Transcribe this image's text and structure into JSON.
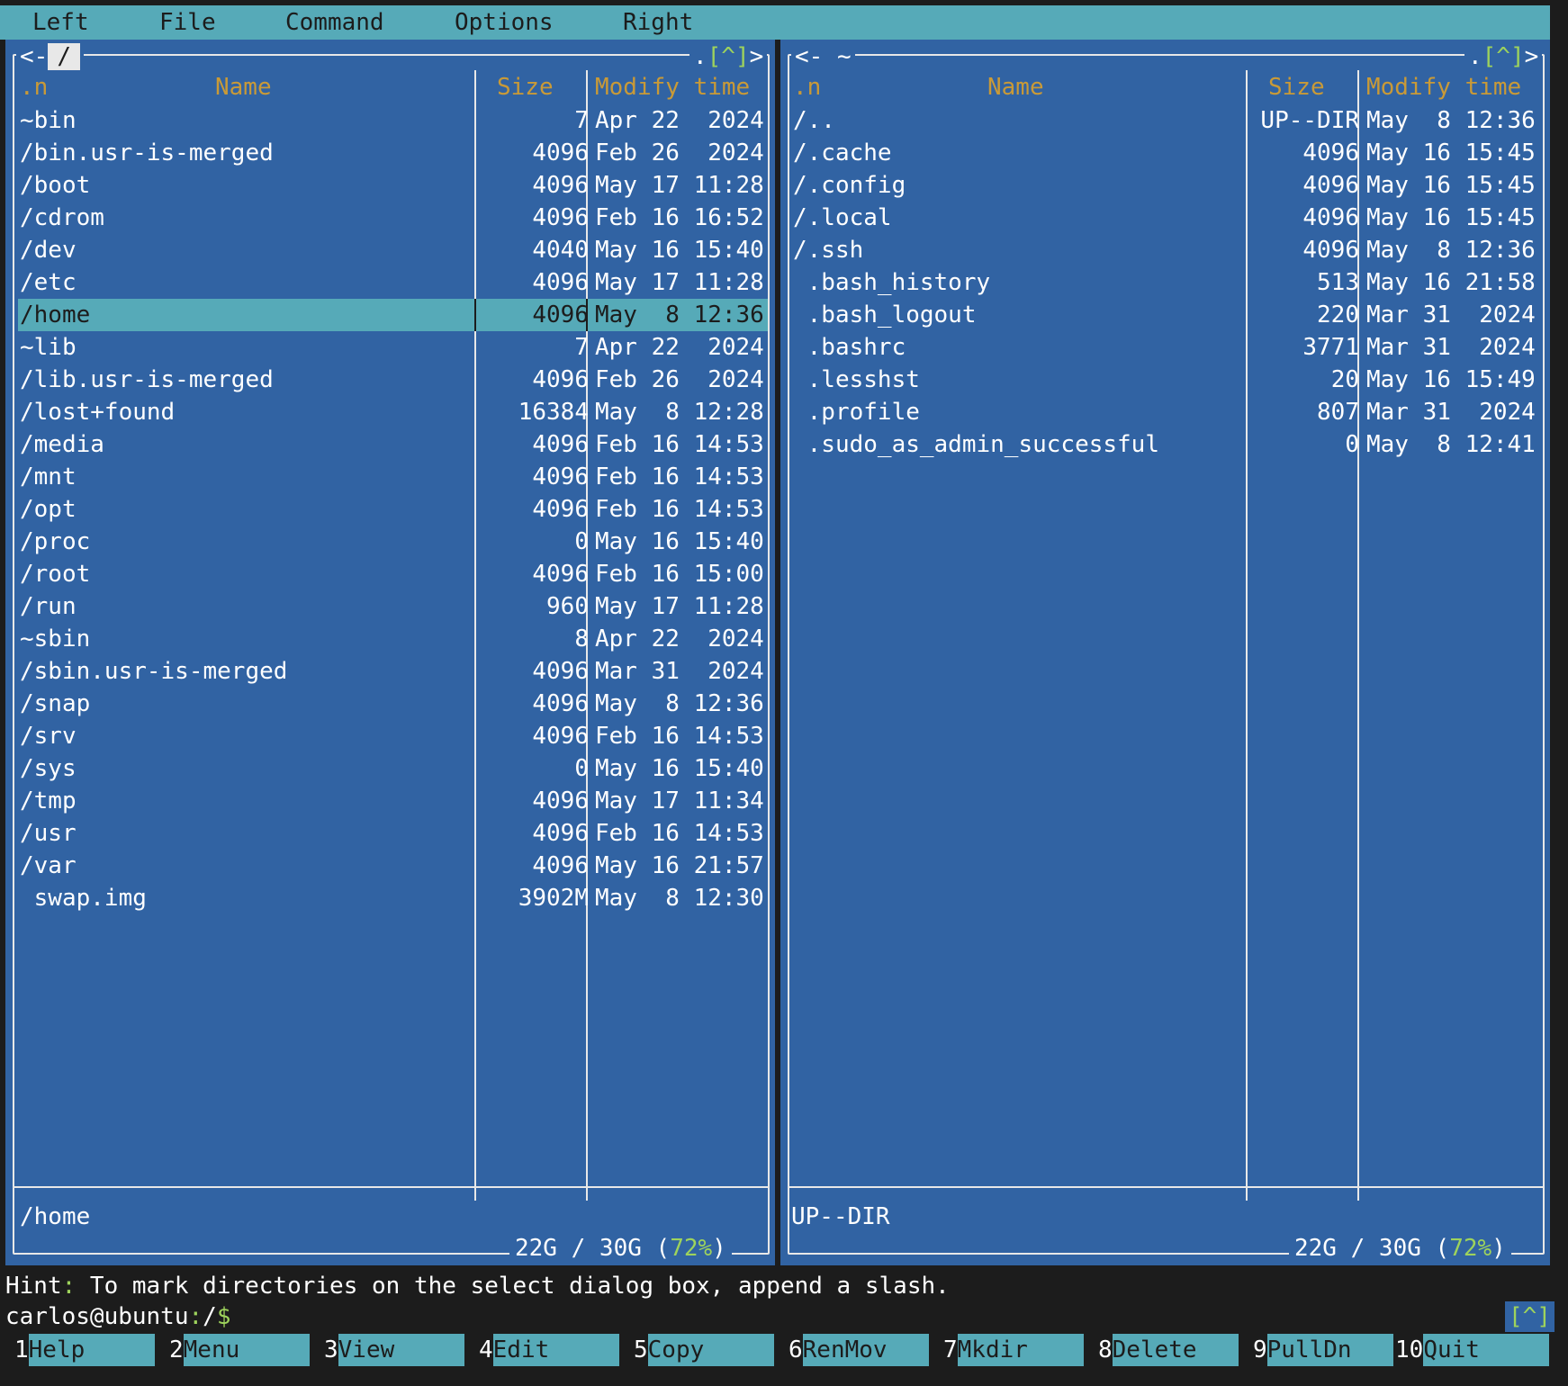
{
  "menubar": [
    "Left",
    "File",
    "Command",
    "Options",
    "Right"
  ],
  "left_panel": {
    "title_left": "<-",
    "path": "/",
    "title_right_dot": ".",
    "history_label": "[^]",
    "title_right_arrow": ">",
    "columns": {
      "n": ".n",
      "name": "Name",
      "size": "Size",
      "time": "Modify time"
    },
    "rows": [
      {
        "name": "~bin",
        "size": "7",
        "time": "Apr 22  2024"
      },
      {
        "name": "/bin.usr-is-merged",
        "size": "4096",
        "time": "Feb 26  2024"
      },
      {
        "name": "/boot",
        "size": "4096",
        "time": "May 17 11:28"
      },
      {
        "name": "/cdrom",
        "size": "4096",
        "time": "Feb 16 16:52"
      },
      {
        "name": "/dev",
        "size": "4040",
        "time": "May 16 15:40"
      },
      {
        "name": "/etc",
        "size": "4096",
        "time": "May 17 11:28"
      },
      {
        "name": "/home",
        "size": "4096",
        "time": "May  8 12:36",
        "selected": true
      },
      {
        "name": "~lib",
        "size": "7",
        "time": "Apr 22  2024"
      },
      {
        "name": "/lib.usr-is-merged",
        "size": "4096",
        "time": "Feb 26  2024"
      },
      {
        "name": "/lost+found",
        "size": "16384",
        "time": "May  8 12:28"
      },
      {
        "name": "/media",
        "size": "4096",
        "time": "Feb 16 14:53"
      },
      {
        "name": "/mnt",
        "size": "4096",
        "time": "Feb 16 14:53"
      },
      {
        "name": "/opt",
        "size": "4096",
        "time": "Feb 16 14:53"
      },
      {
        "name": "/proc",
        "size": "0",
        "time": "May 16 15:40"
      },
      {
        "name": "/root",
        "size": "4096",
        "time": "Feb 16 15:00"
      },
      {
        "name": "/run",
        "size": "960",
        "time": "May 17 11:28"
      },
      {
        "name": "~sbin",
        "size": "8",
        "time": "Apr 22  2024"
      },
      {
        "name": "/sbin.usr-is-merged",
        "size": "4096",
        "time": "Mar 31  2024"
      },
      {
        "name": "/snap",
        "size": "4096",
        "time": "May  8 12:36"
      },
      {
        "name": "/srv",
        "size": "4096",
        "time": "Feb 16 14:53"
      },
      {
        "name": "/sys",
        "size": "0",
        "time": "May 16 15:40"
      },
      {
        "name": "/tmp",
        "size": "4096",
        "time": "May 17 11:34"
      },
      {
        "name": "/usr",
        "size": "4096",
        "time": "Feb 16 14:53"
      },
      {
        "name": "/var",
        "size": "4096",
        "time": "May 16 21:57"
      },
      {
        "name": " swap.img",
        "size": "3902M",
        "time": "May  8 12:30"
      }
    ],
    "status": "/home",
    "disk_used": "22G / 30G (",
    "disk_pct": "72%",
    "disk_close": ")"
  },
  "right_panel": {
    "title_left": "<-",
    "path": "~",
    "title_right_dot": ".",
    "history_label": "[^]",
    "title_right_arrow": ">",
    "columns": {
      "n": ".n",
      "name": "Name",
      "size": "Size",
      "time": "Modify time"
    },
    "rows": [
      {
        "name": "/..",
        "size": "UP--DIR",
        "time": "May  8 12:36"
      },
      {
        "name": "/.cache",
        "size": "4096",
        "time": "May 16 15:45"
      },
      {
        "name": "/.config",
        "size": "4096",
        "time": "May 16 15:45"
      },
      {
        "name": "/.local",
        "size": "4096",
        "time": "May 16 15:45"
      },
      {
        "name": "/.ssh",
        "size": "4096",
        "time": "May  8 12:36"
      },
      {
        "name": " .bash_history",
        "size": "513",
        "time": "May 16 21:58"
      },
      {
        "name": " .bash_logout",
        "size": "220",
        "time": "Mar 31  2024"
      },
      {
        "name": " .bashrc",
        "size": "3771",
        "time": "Mar 31  2024"
      },
      {
        "name": " .lesshst",
        "size": "20",
        "time": "May 16 15:49"
      },
      {
        "name": " .profile",
        "size": "807",
        "time": "Mar 31  2024"
      },
      {
        "name": " .sudo_as_admin_successful",
        "size": "0",
        "time": "May  8 12:41"
      }
    ],
    "status": "UP--DIR",
    "disk_used": "22G / 30G (",
    "disk_pct": "72%",
    "disk_close": ")"
  },
  "hint": {
    "label": "Hint",
    "colon": ":",
    "text": " To mark directories on the select dialog box, append a slash."
  },
  "prompt": {
    "user_host": "carlos@ubuntu",
    "colon": ":",
    "path": "/",
    "symbol": "$",
    "history_label": "[^]"
  },
  "fkeys": [
    {
      "num": "1",
      "label": "Help"
    },
    {
      "num": "2",
      "label": "Menu"
    },
    {
      "num": "3",
      "label": "View"
    },
    {
      "num": "4",
      "label": "Edit"
    },
    {
      "num": "5",
      "label": "Copy"
    },
    {
      "num": "6",
      "label": "RenMov"
    },
    {
      "num": "7",
      "label": "Mkdir"
    },
    {
      "num": "8",
      "label": "Delete"
    },
    {
      "num": "9",
      "label": "PullDn"
    },
    {
      "num": "10",
      "label": "Quit"
    }
  ],
  "colors": {
    "panel_bg": "#3163a3",
    "accent_cyan": "#56aab8",
    "header_gold": "#c99a37",
    "hist_green": "#9ed35c",
    "terminal_bg": "#1c1c1c"
  }
}
